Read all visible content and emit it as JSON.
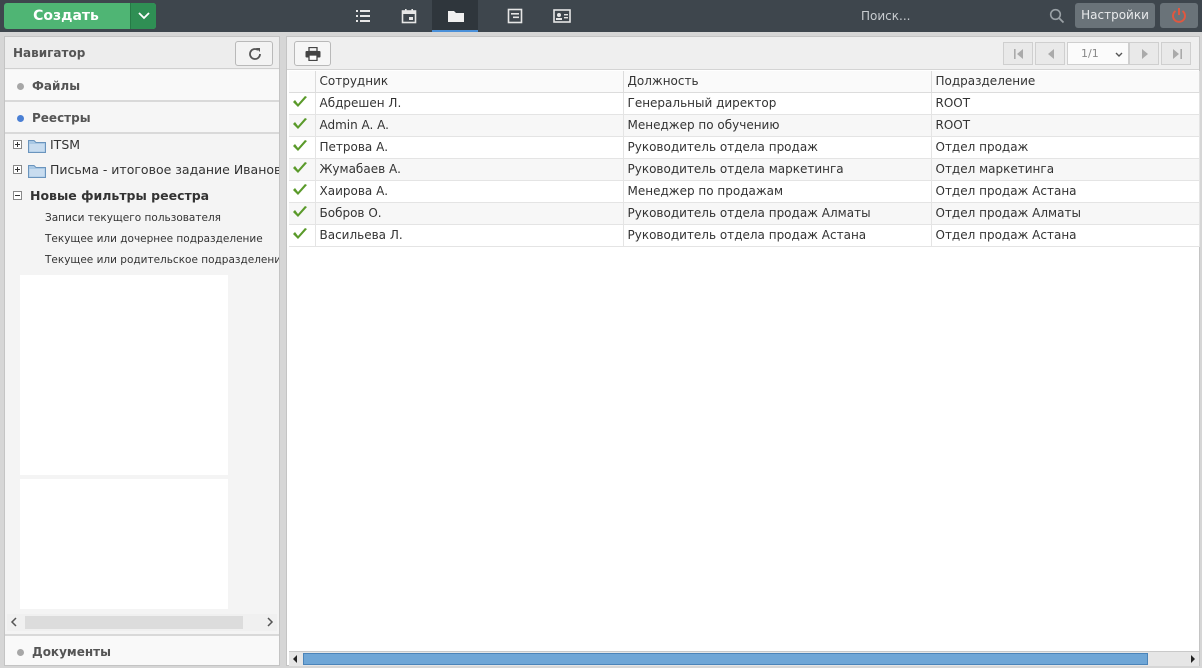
{
  "topbar": {
    "create_label": "Создать",
    "search_placeholder": "Поиск...",
    "settings_label": "Настройки",
    "icons": [
      "list-icon",
      "calendar-icon",
      "folder-icon",
      "inbox-icon",
      "contact-card-icon"
    ],
    "active_tab": "folder-icon"
  },
  "navigator": {
    "title": "Навигатор",
    "sections": {
      "files": "Файлы",
      "registries": "Реестры",
      "documents": "Документы"
    },
    "tree": {
      "itsm": "ITSM",
      "letters": "Письма - итоговое задание Иванова",
      "new_filters": "Новые фильтры реестра",
      "leaves": [
        "Записи текущего пользователя",
        "Текущее или дочернее подразделение",
        "Текущее или родительское подразделение"
      ]
    }
  },
  "pager": {
    "label": "1/1"
  },
  "table": {
    "headers": [
      "Сотрудник",
      "Должность",
      "Подразделение"
    ],
    "rows": [
      [
        "Абдрешен Л.",
        "Генеральный директор",
        "ROOT"
      ],
      [
        "Admin A. A.",
        "Менеджер по обучению",
        "ROOT"
      ],
      [
        "Петрова А.",
        "Руководитель отдела продаж",
        "Отдел продаж"
      ],
      [
        "Жумабаев А.",
        "Руководитель отдела маркетинга",
        "Отдел маркетинга"
      ],
      [
        "Хаирова А.",
        "Менеджер по продажам",
        "Отдел продаж Астана"
      ],
      [
        "Бобров О.",
        "Руководитель отдела продаж Алматы",
        "Отдел продаж Алматы"
      ],
      [
        "Васильева Л.",
        "Руководитель отдела продаж Астана",
        "Отдел продаж Астана"
      ]
    ]
  },
  "colors": {
    "accent": "#4fb574",
    "topbar": "#3e464d",
    "active_underline": "#4a90d9",
    "check": "#5a9a2a"
  }
}
